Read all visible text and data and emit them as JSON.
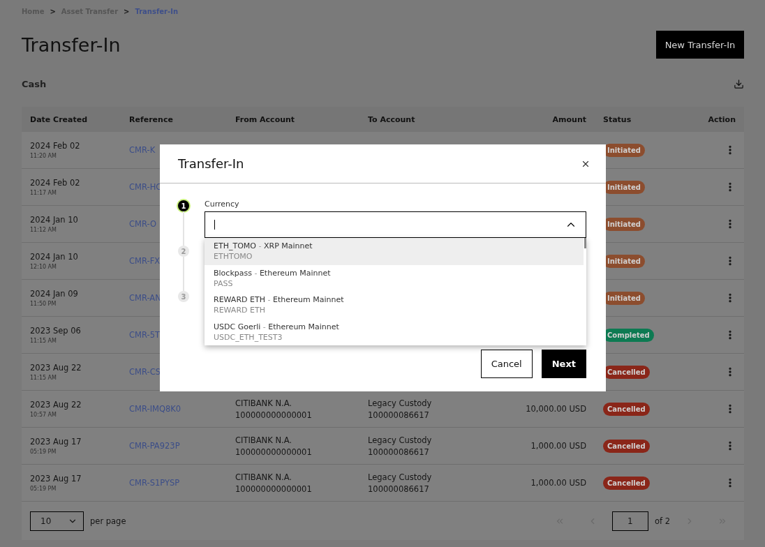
{
  "breadcrumb": [
    {
      "label": "Home",
      "current": false
    },
    {
      "label": ">",
      "kind": "sep"
    },
    {
      "label": "Asset Transfer",
      "current": false
    },
    {
      "label": ">",
      "kind": "sep"
    },
    {
      "label": "Transfer-In",
      "current": true
    }
  ],
  "title": "Transfer-In",
  "new_button": "New Transfer-In",
  "section": "Cash",
  "table": {
    "columns": [
      "Date Created",
      "Reference",
      "From Account",
      "To Account",
      "Amount",
      "Status",
      "Action"
    ],
    "rows": [
      {
        "date": "2024 Feb 02",
        "time": "11:20 AM",
        "reference": "CMR-K",
        "status": {
          "label": "Initiated",
          "color": "#8c4d2e"
        }
      },
      {
        "date": "2024 Feb 02",
        "time": "11:17 AM",
        "reference": "CMR-HC",
        "status": {
          "label": "Initiated",
          "color": "#8c4d2e"
        }
      },
      {
        "date": "2024 Jan 10",
        "time": "11:12 AM",
        "reference": "CMR-O",
        "status": {
          "label": "Initiated",
          "color": "#8c4d2e"
        }
      },
      {
        "date": "2024 Jan 10",
        "time": "12:10 AM",
        "reference": "CMR-FX",
        "status": {
          "label": "Initiated",
          "color": "#8c4d2e"
        }
      },
      {
        "date": "2024 Jan 09",
        "time": "11:50 PM",
        "reference": "CMR-AN",
        "status": {
          "label": "Initiated",
          "color": "#8c4d2e"
        }
      },
      {
        "date": "2023 Sep 06",
        "time": "11:15 AM",
        "reference": "CMR-5T",
        "status": {
          "label": "Completed",
          "color": "#0d7a52"
        }
      },
      {
        "date": "2023 Aug 22",
        "time": "11:15 AM",
        "reference": "CMR-CS",
        "status": {
          "label": "Cancelled",
          "color": "#8a2619"
        }
      },
      {
        "date": "2023 Aug 22",
        "time": "10:57 AM",
        "reference": "CMR-IMQ8K0",
        "from": "CITIBANK N.A.",
        "from_no": "100000000000001",
        "to": "Legacy Custody",
        "to_no": "100000086617",
        "amount": "10,000.00 USD",
        "status": {
          "label": "Cancelled",
          "color": "#8a2619"
        }
      },
      {
        "date": "2023 Aug 17",
        "time": "05:19 PM",
        "reference": "CMR-PA923P",
        "from": "CITIBANK N.A.",
        "from_no": "100000000000001",
        "to": "Legacy Custody",
        "to_no": "100000086617",
        "amount": "1,000.00 USD",
        "status": {
          "label": "Cancelled",
          "color": "#8a2619"
        }
      },
      {
        "date": "2023 Aug 17",
        "time": "05:19 PM",
        "reference": "CMR-S1PYSP",
        "from": "CITIBANK N.A.",
        "from_no": "100000000000001",
        "to": "Legacy Custody",
        "to_no": "100000086617",
        "amount": "1,000.00 USD",
        "status": {
          "label": "Cancelled",
          "color": "#8a2619"
        }
      }
    ]
  },
  "pagination": {
    "per_page": "10",
    "per_page_label": "per page",
    "page": "1",
    "of": "of 2",
    "first_disabled": true,
    "prev_disabled": true,
    "next_disabled": true,
    "last_disabled": true
  },
  "modal": {
    "title": "Transfer-In",
    "steps": [
      {
        "number": "1",
        "active": true
      },
      {
        "number": "2",
        "active": false
      },
      {
        "number": "3",
        "active": false
      }
    ],
    "currency_label": "Currency",
    "options": [
      {
        "name": "ETH_TOMO",
        "separator": "-",
        "network": "XRP Mainnet",
        "code": "ETHTOMO",
        "selected": true
      },
      {
        "name": "Blockpass",
        "separator": "-",
        "network": "Ethereum Mainnet",
        "code": "PASS",
        "selected": false
      },
      {
        "name": "REWARD ETH",
        "separator": "-",
        "network": "Ethereum Mainnet",
        "code": "REWARD ETH",
        "selected": false
      },
      {
        "name": "USDC Goerli",
        "separator": "-",
        "network": "Ethereum Mainnet",
        "code": "USDC_ETH_TEST3",
        "selected": false
      }
    ],
    "buttons": [
      {
        "label": "Cancel",
        "kind": "secondary"
      },
      {
        "label": "Next",
        "kind": "primary"
      }
    ]
  }
}
